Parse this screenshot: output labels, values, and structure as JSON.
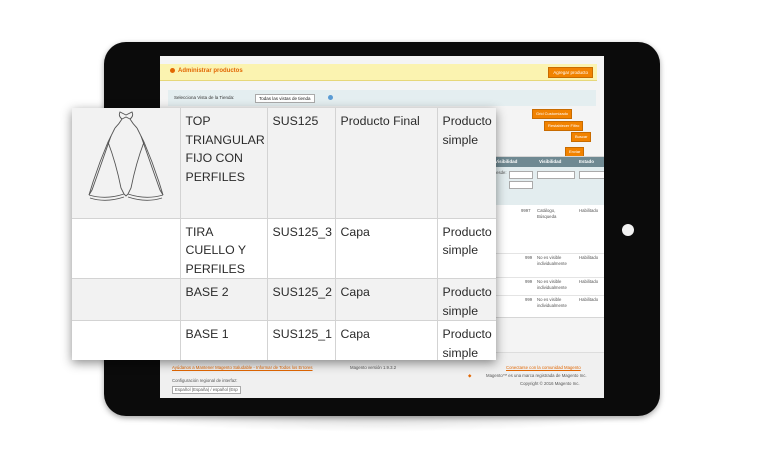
{
  "background_screen": {
    "header_title": "Administrar productos",
    "add_button_label": "Agregar producto",
    "store_view_label": "Selecciona Vista de la Tienda:",
    "store_view_value": "Todas las vistas de tienda",
    "buttons": {
      "grid_label": "Grid Customizado",
      "reset_filter": "Restablecer Filtro",
      "search": "Buscar",
      "submit": "Enviar"
    },
    "grid_columns": [
      "Visibilidad",
      "Visibilidad",
      "Estado"
    ],
    "filter_label": "Desde:",
    "rows": [
      {
        "qty": "9997",
        "visibility": "Catálogo, Búsqueda",
        "status": "Habilitado"
      },
      {
        "qty": "999",
        "visibility": "No es visible individualmente",
        "status": "Habilitado"
      },
      {
        "qty": "999",
        "visibility": "No es visible individualmente",
        "status": "Habilitado"
      },
      {
        "qty": "999",
        "visibility": "No es visible individualmente",
        "status": "Habilitado"
      }
    ],
    "footer": {
      "help_link": "Ayúdanos a Mantener Magento Saludable - Informar de Todos los Errores",
      "version": "Magento versión 1.9.3.2",
      "community_link": "Conectarse con la comunidad Magento",
      "trademark": "Magento™ es una marca registrada de Magento Inc.",
      "copyright": "Copyright © 2016 Magento Inc.",
      "locale_label": "Configuración regional de interfaz:",
      "locale_value": "Español (España) / español (Esp"
    }
  },
  "product_table": {
    "rows": [
      {
        "image": "bikini-top-drawing",
        "name": "TOP TRIANGULAR FIJO CON PERFILES",
        "sku": "SUS125",
        "role": "Producto Final",
        "type": "Producto simple"
      },
      {
        "image": "",
        "name": "TIRA CUELLO Y PERFILES",
        "sku": "SUS125_3",
        "role": "Capa",
        "type": "Producto simple"
      },
      {
        "image": "",
        "name": "BASE 2",
        "sku": "SUS125_2",
        "role": "Capa",
        "type": "Producto simple"
      },
      {
        "image": "",
        "name": "BASE 1",
        "sku": "SUS125_1",
        "role": "Capa",
        "type": "Producto simple"
      }
    ]
  },
  "colors": {
    "accent_orange": "#f18200",
    "header_yellow": "#fbf3b0",
    "tablet_bezel": "#0b0b0b"
  }
}
